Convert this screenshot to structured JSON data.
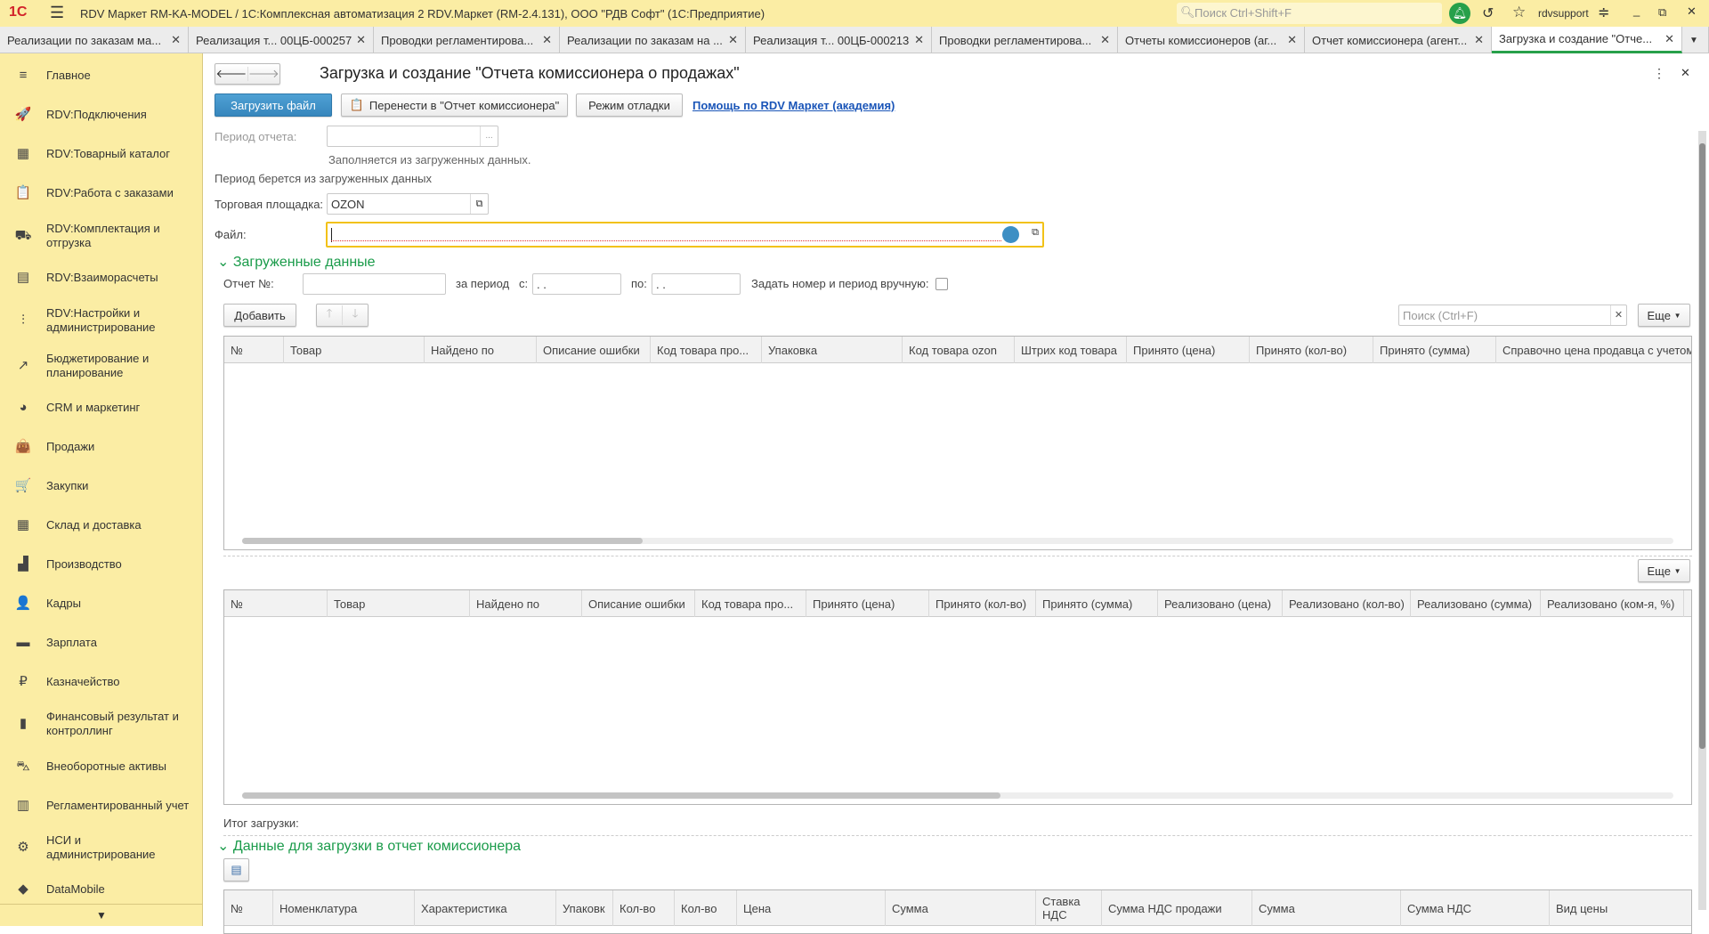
{
  "titlebar": {
    "title": "RDV Маркет RM-KA-MODEL / 1С:Комплексная автоматизация 2 RDV.Маркет (RM-2.4.131), ООО \"РДВ Софт\"  (1С:Предприятие)",
    "search_placeholder": "Поиск Ctrl+Shift+F",
    "user": "rdvsupport",
    "logo": "1С"
  },
  "tabs": [
    {
      "label": "Реализации по заказам ма..."
    },
    {
      "label": "Реализация т...  00ЦБ-000257"
    },
    {
      "label": "Проводки регламентирова..."
    },
    {
      "label": "Реализации по заказам на ..."
    },
    {
      "label": "Реализация т...  00ЦБ-000213"
    },
    {
      "label": "Проводки регламентирова..."
    },
    {
      "label": "Отчеты комиссионеров (аг..."
    },
    {
      "label": "Отчет комиссионера (агент..."
    },
    {
      "label": "Загрузка и создание \"Отче...",
      "active": true
    }
  ],
  "sidebar": {
    "items": [
      {
        "label": "Главное",
        "icon": "≡"
      },
      {
        "label": "RDV:Подключения",
        "icon": "🚀"
      },
      {
        "label": "RDV:Товарный каталог",
        "icon": "▦"
      },
      {
        "label": "RDV:Работа с заказами",
        "icon": "📋"
      },
      {
        "label": "RDV:Комплектация и отгрузка",
        "icon": "⛟"
      },
      {
        "label": "RDV:Взаиморасчеты",
        "icon": "▤"
      },
      {
        "label": "RDV:Настройки и администрирование",
        "icon": "⫶"
      },
      {
        "label": "Бюджетирование и планирование",
        "icon": "↗"
      },
      {
        "label": "CRM и маркетинг",
        "icon": "◕"
      },
      {
        "label": "Продажи",
        "icon": "👜"
      },
      {
        "label": "Закупки",
        "icon": "🛒"
      },
      {
        "label": "Склад и доставка",
        "icon": "▦"
      },
      {
        "label": "Производство",
        "icon": "▟"
      },
      {
        "label": "Кадры",
        "icon": "👤"
      },
      {
        "label": "Зарплата",
        "icon": "▬"
      },
      {
        "label": "Казначейство",
        "icon": "₽"
      },
      {
        "label": "Финансовый результат и контроллинг",
        "icon": "▮"
      },
      {
        "label": "Внеоборотные активы",
        "icon": "⛍"
      },
      {
        "label": "Регламентированный учет",
        "icon": "▥"
      },
      {
        "label": "НСИ и администрирование",
        "icon": "⚙"
      },
      {
        "label": "DataMobile",
        "icon": "◆"
      }
    ]
  },
  "form": {
    "title": "Загрузка и создание \"Отчета комиссионера о продажах\"",
    "load_file": "Загрузить файл",
    "transfer": "Перенести в \"Отчет комиссионера\"",
    "debug": "Режим отладки",
    "help_link": "Помощь по RDV Маркет (академия)",
    "period_label": "Период отчета:",
    "period_value": "",
    "period_hint": "Заполняется из загруженных данных.",
    "period_note": "Период берется из загруженных данных",
    "marketplace_label": "Торговая площадка:",
    "marketplace_value": "OZON",
    "file_label": "Файл:",
    "file_value": "",
    "loaded_section": "Загруженные данные",
    "report_no_label": "Отчет №:",
    "report_no": "",
    "for_period": "за период",
    "from_label": "с:",
    "from_value": ". .",
    "to_label": "по:",
    "to_value": ". .",
    "manual_label": "Задать номер и период вручную:",
    "add": "Добавить",
    "search_placeholder": "Поиск (Ctrl+F)",
    "more": "Еще",
    "total_label": "Итог загрузки:",
    "data_section": "Данные для загрузки в отчет комиссионера"
  },
  "table1": {
    "columns": [
      "№",
      "Товар",
      "Найдено по",
      "Описание ошибки",
      "Код товара про...",
      "Упаковка",
      "Код товара ozon",
      "Штрих код товара",
      "Принято (цена)",
      "Принято (кол-во)",
      "Принято (сумма)",
      "Справочно цена продавца с учетом"
    ]
  },
  "table2": {
    "columns": [
      "№",
      "Товар",
      "Найдено по",
      "Описание ошибки",
      "Код товара про...",
      "Принято (цена)",
      "Принято (кол-во)",
      "Принято (сумма)",
      "Реализовано (цена)",
      "Реализовано (кол-во)",
      "Реализовано (сумма)",
      "Реализовано (ком-я, %)",
      "Р"
    ]
  },
  "table3": {
    "columns": [
      "№",
      "Номенклатура",
      "Характеристика",
      "Упаковк",
      "Кол-во",
      "Кол-во",
      "Цена",
      "Сумма",
      "Ставка НДС",
      "Сумма НДС продажи",
      "Сумма",
      "Сумма НДС",
      "Вид цены"
    ]
  },
  "colors": {
    "accent": "#27a04a",
    "primary_button": "#3d8fc4",
    "sidebar": "#fbeda4",
    "focus": "#f2c218"
  }
}
